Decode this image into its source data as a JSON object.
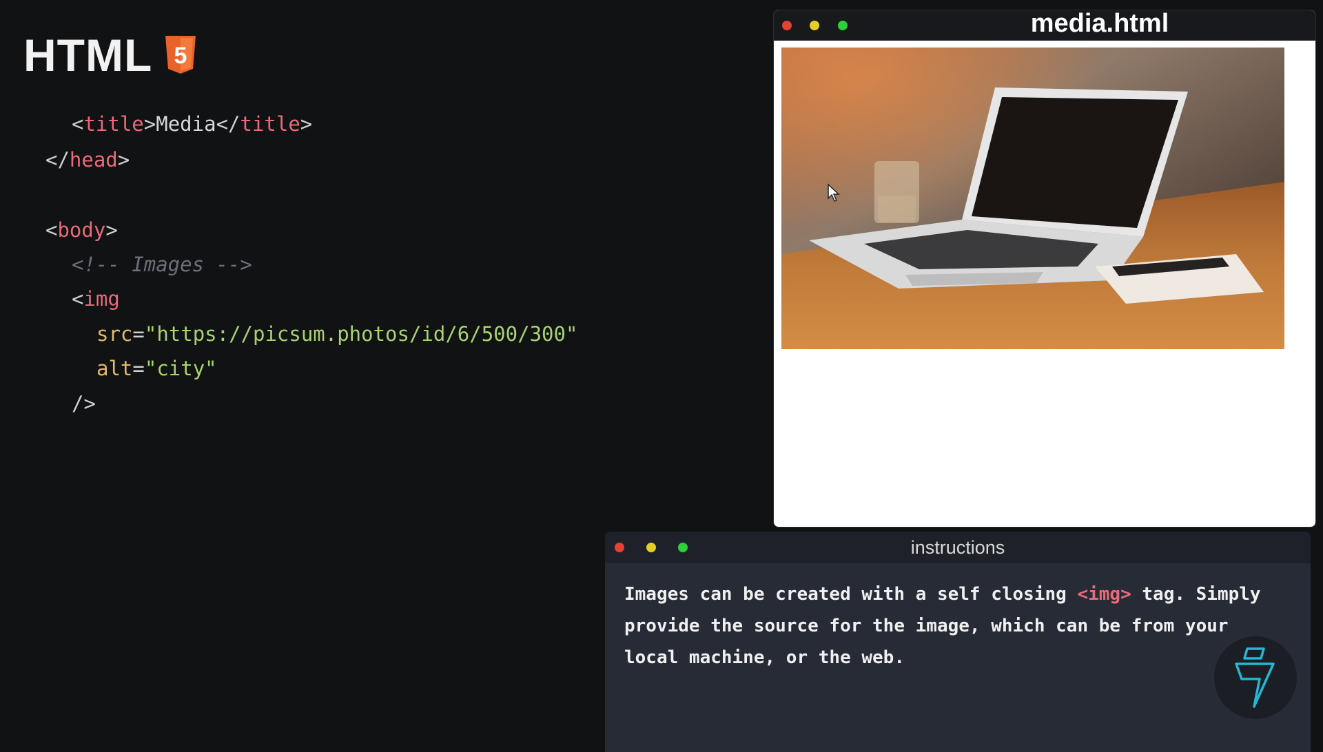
{
  "logo": {
    "text": "HTML",
    "icon": "html5-shield-icon",
    "icon_color": "#e8622c",
    "icon_digit": "5"
  },
  "editor": {
    "lines": {
      "l1": {
        "open_lt": "<",
        "tag_open": "title",
        "gt1": ">",
        "text": "Media",
        "lt2": "</",
        "tag_close": "title",
        "gt2": ">"
      },
      "l2": {
        "lt": "</",
        "tag": "head",
        "gt": ">"
      },
      "l3": {
        "lt": "<",
        "tag": "body",
        "gt": ">"
      },
      "l4": {
        "comment": "<!-- Images -->"
      },
      "l5": {
        "lt": "<",
        "tag": "img"
      },
      "l6": {
        "attr": "src",
        "eq": "=",
        "value": "\"https://picsum.photos/id/6/500/300\""
      },
      "l7": {
        "attr": "alt",
        "eq": "=",
        "value": "\"city\""
      },
      "l8": {
        "close": "/>"
      }
    }
  },
  "browser": {
    "title": "media.html",
    "image": {
      "description_icon": "laptop-photo"
    }
  },
  "instructions": {
    "title": "instructions",
    "text_part1": "Images can be created with a self closing ",
    "tag": "<img>",
    "text_part2": " tag. Simply provide the source for the image, which can be from your local machine, or the web."
  },
  "colors": {
    "background": "#111213",
    "tag": "#ea6a7a",
    "attribute": "#e3b96a",
    "string": "#a9d36f",
    "comment": "#6b6f78",
    "dot_red": "#e34234",
    "dot_yellow": "#e5cf24",
    "dot_green": "#2fcf3a"
  }
}
